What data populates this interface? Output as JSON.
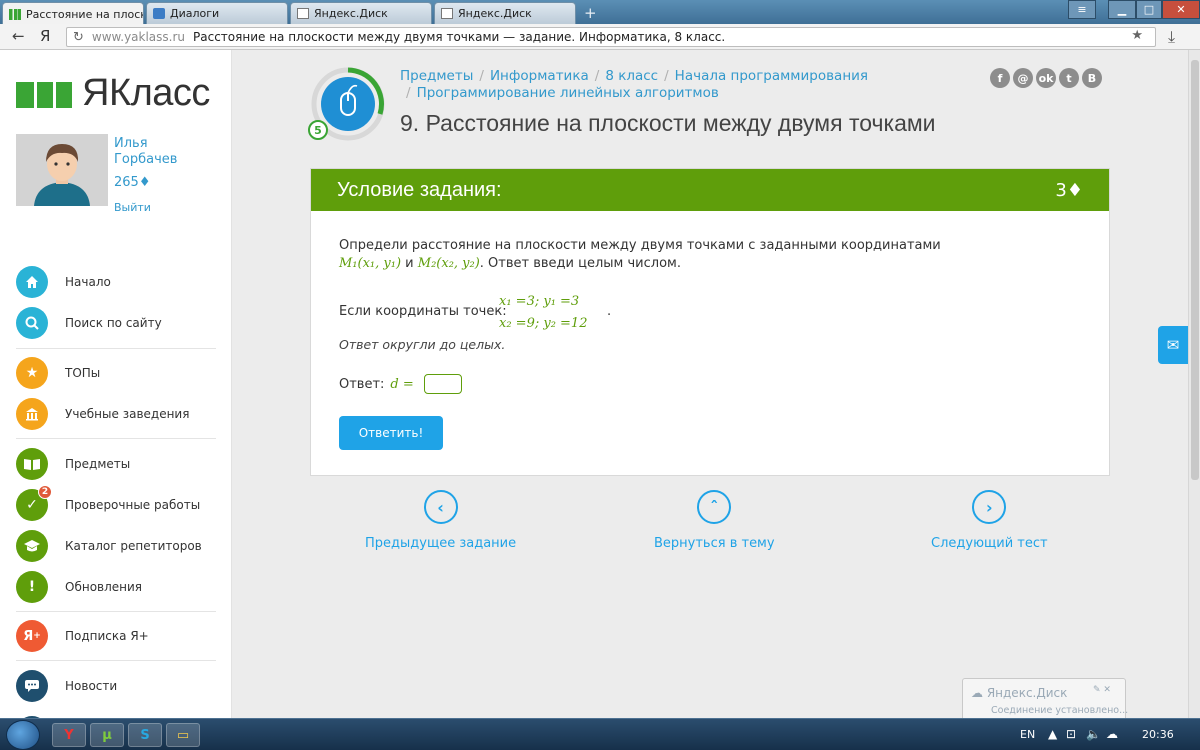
{
  "browser": {
    "tabs": [
      {
        "label": "Расстояние на плоско",
        "favicon": "yaklass-logo-icon"
      },
      {
        "label": "Диалоги",
        "favicon": "dialog-icon"
      },
      {
        "label": "Яндекс.Диск",
        "favicon": "yandex-disk-icon"
      },
      {
        "label": "Яндекс.Диск",
        "favicon": "document-icon"
      }
    ],
    "yandex_letter": "Я",
    "url_domain": "www.yaklass.ru",
    "url_title": "Расстояние на плоскости между двумя точками — задание. Информатика, 8 класс."
  },
  "sidebar": {
    "logo_text": "ЯКласс",
    "user_name": "Илья Горбачев",
    "user_points": "265♦",
    "logout_label": "Выйти",
    "items": [
      {
        "label": "Начало",
        "icon": "home-icon",
        "color": "#2ab3d6"
      },
      {
        "label": "Поиск по сайту",
        "icon": "search-icon",
        "color": "#2ab3d6"
      },
      {
        "label": "ТОПы",
        "icon": "star-icon",
        "color": "#f5a51c"
      },
      {
        "label": "Учебные заведения",
        "icon": "school-icon",
        "color": "#f5a51c"
      },
      {
        "label": "Предметы",
        "icon": "book-icon",
        "color": "#5f9e0b"
      },
      {
        "label": "Проверочные работы",
        "icon": "check-icon",
        "color": "#5f9e0b",
        "badge": "2"
      },
      {
        "label": "Каталог репетиторов",
        "icon": "graduation-cap-icon",
        "color": "#5f9e0b"
      },
      {
        "label": "Обновления",
        "icon": "exclamation-icon",
        "color": "#5f9e0b"
      },
      {
        "label": "Подписка Я+",
        "icon": "ya-plus-icon",
        "color": "#ef5a33"
      },
      {
        "label": "Новости",
        "icon": "chat-icon",
        "color": "#1f4f6e"
      }
    ]
  },
  "breadcrumb": {
    "items": [
      "Предметы",
      "Информатика",
      "8 класс",
      "Начала программирования"
    ],
    "second_line": "Программирование линейных алгоритмов"
  },
  "level": "5",
  "page_title": "9. Расстояние на плоскости между двумя точками",
  "socials": [
    "f",
    "@",
    "ok",
    "tw",
    "B"
  ],
  "task": {
    "header_title": "Условие задания:",
    "points": "3♦",
    "text_line1": "Определи расстояние на плоскости между двумя точками с заданными координатами",
    "m1": "M₁(x₁, y₁)",
    "and_word": "и",
    "m2": "M₂(x₂, y₂)",
    "text_line2_end": ". Ответ введи целым числом.",
    "coords_label": "Если координаты точек:",
    "coord_line1": "x₁ =3; y₁ =3",
    "coord_line2": "x₂ =9; y₂ =12",
    "coords_dot": ".",
    "hint": "Ответ округли до целых.",
    "answer_label": "Ответ:",
    "answer_var": "d =",
    "submit_label": "Ответить!"
  },
  "navigation": {
    "prev_label": "Предыдущее задание",
    "up_label": "Вернуться в тему",
    "next_label": "Следующий тест"
  },
  "toast": {
    "title": "Яндекс.Диск",
    "subtitle": "Соединение установлено..."
  },
  "taskbar": {
    "language": "EN",
    "clock": "20:36"
  }
}
